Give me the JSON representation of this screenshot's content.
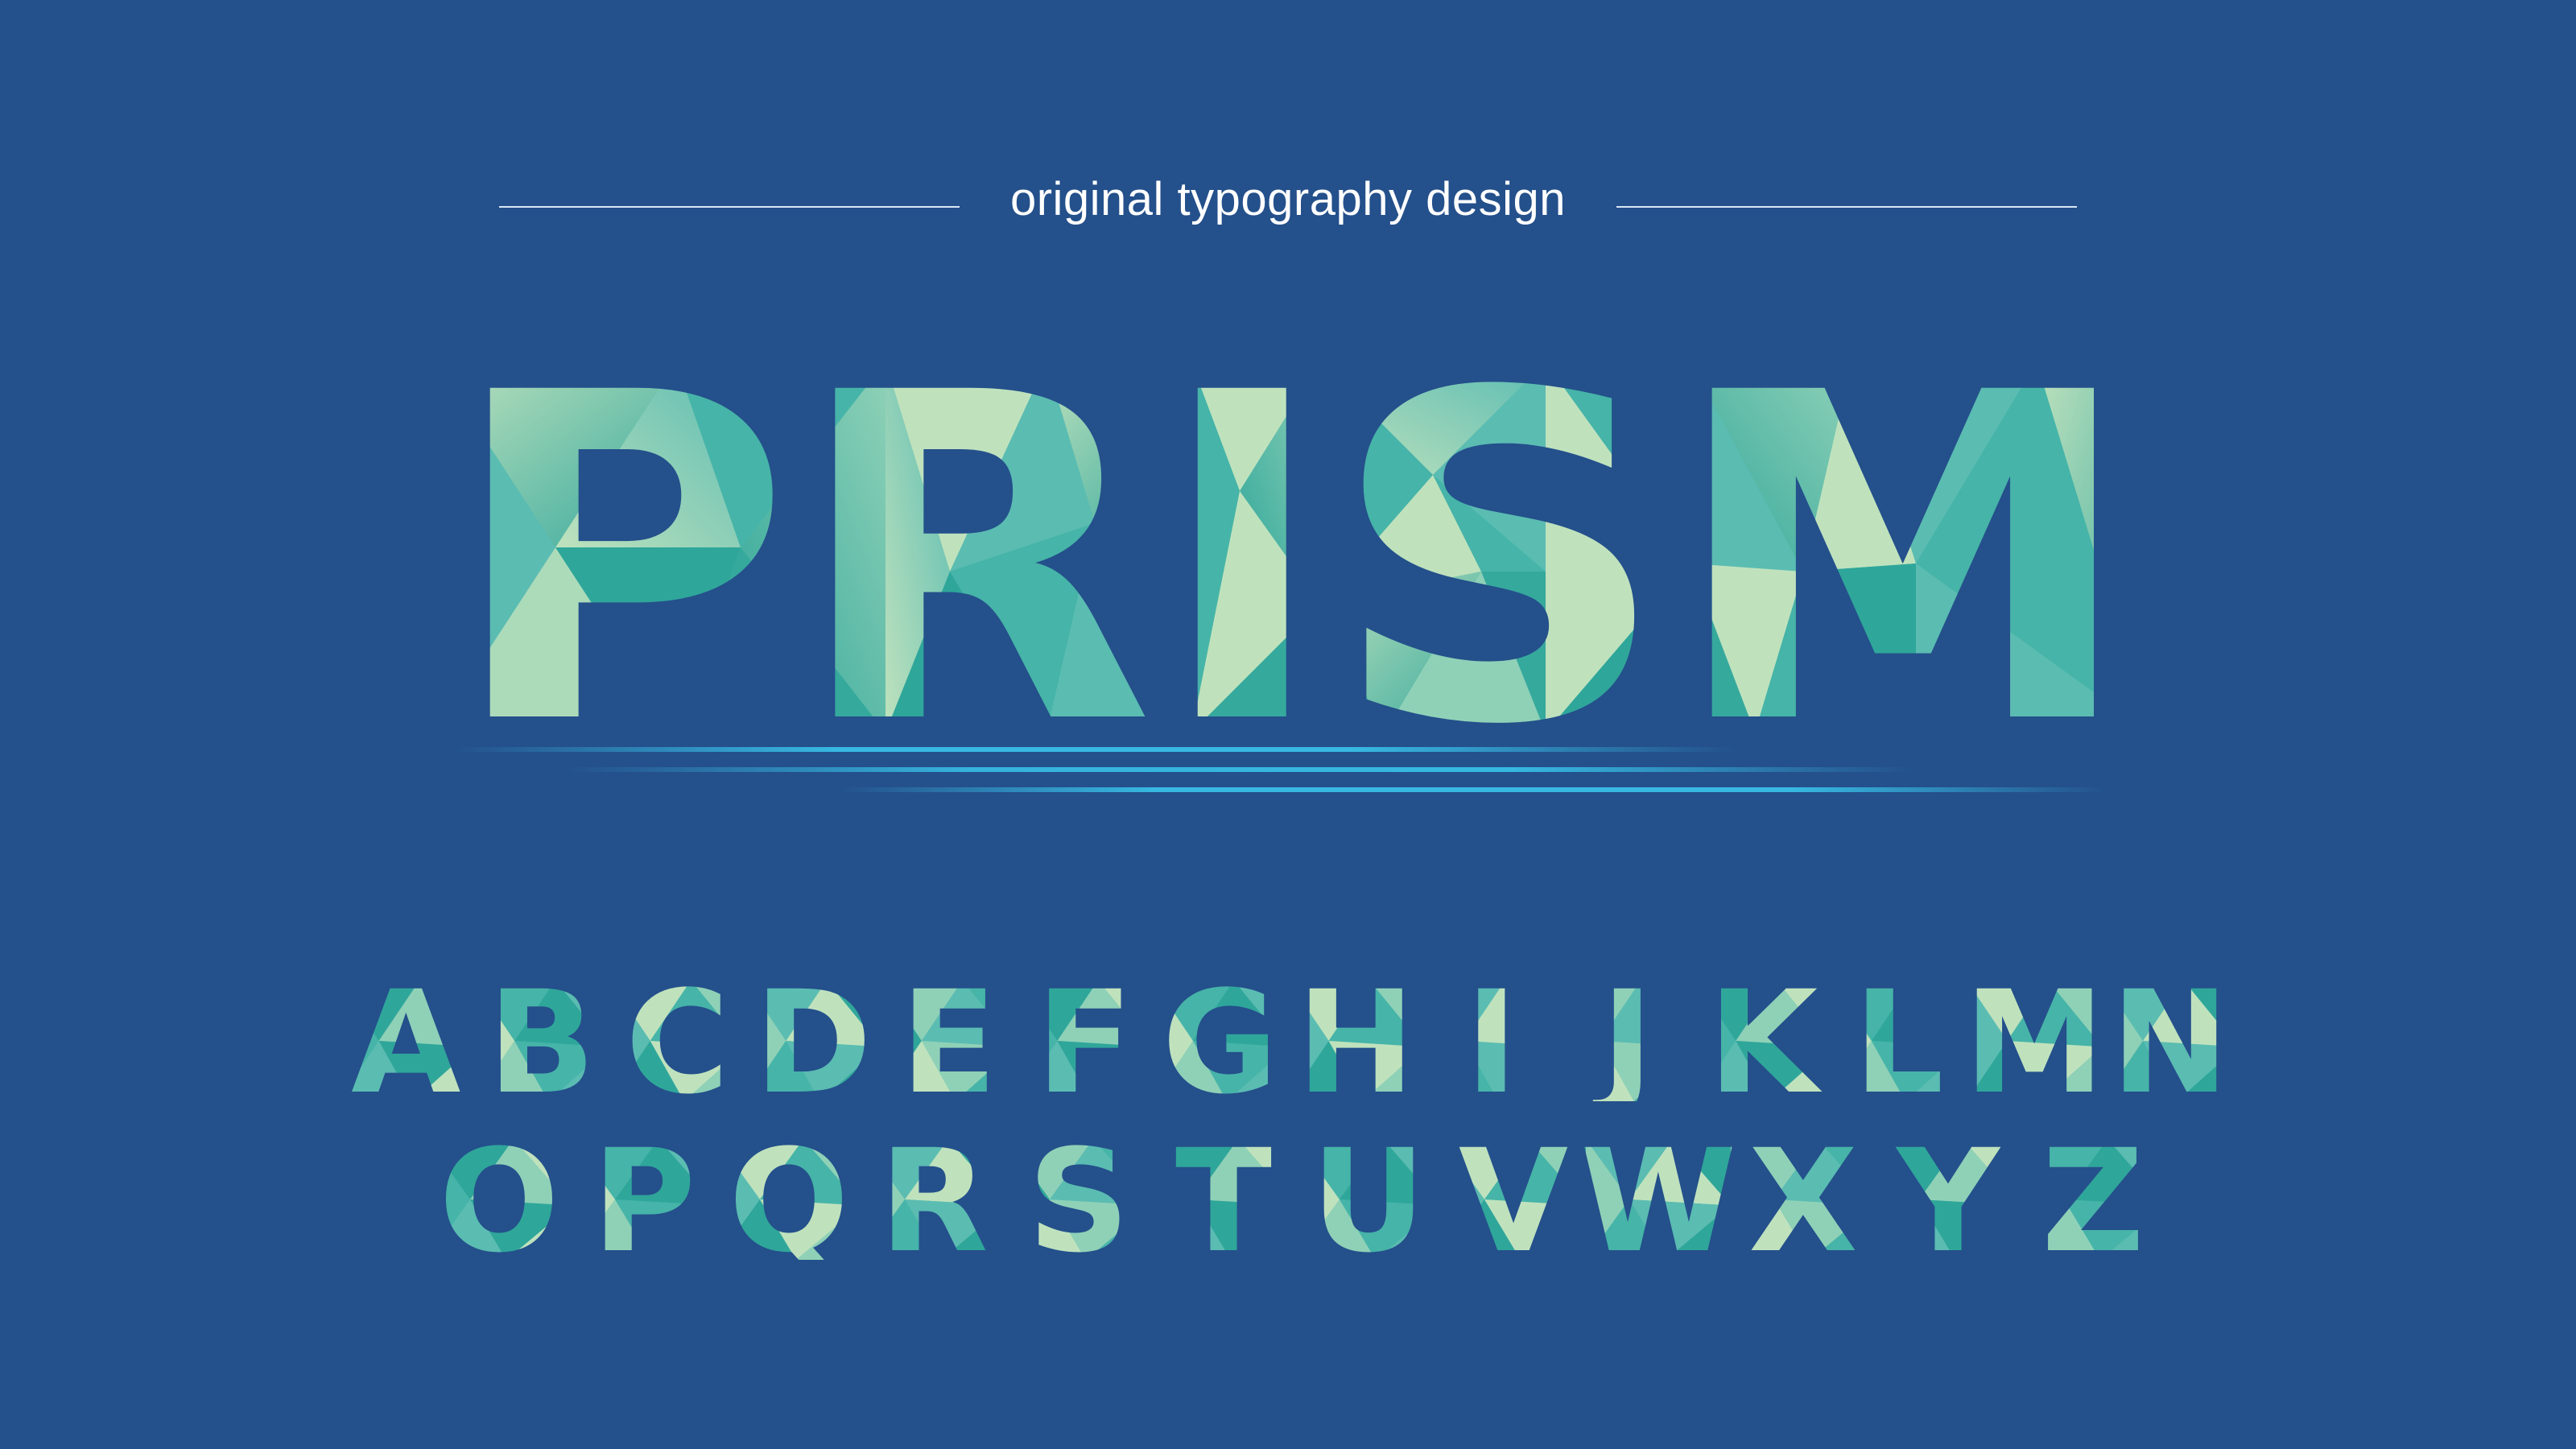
{
  "header": {
    "text": "original typography design"
  },
  "title": {
    "text": "PRISM"
  },
  "alphabet": {
    "row1": [
      "A",
      "B",
      "C",
      "D",
      "E",
      "F",
      "G",
      "H",
      "I",
      "J",
      "K",
      "L",
      "M",
      "N"
    ],
    "row2": [
      "O",
      "P",
      "Q",
      "R",
      "S",
      "T",
      "U",
      "V",
      "W",
      "X",
      "Y",
      "Z"
    ]
  },
  "colors": {
    "background": "#24508b",
    "letter_dark": "#2fa69a",
    "letter_mid": "#46b4a8",
    "letter_light": "#bfe2bd",
    "speed_line": "#39c4eb",
    "header_text": "#ffffff"
  }
}
